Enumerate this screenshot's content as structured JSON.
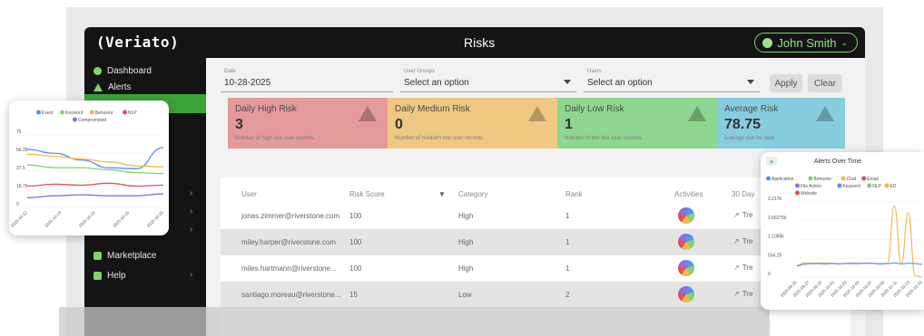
{
  "app": {
    "logo": "(Veriato)",
    "page_title": "Risks",
    "user": {
      "name": "John Smith"
    }
  },
  "sidebar": {
    "items": [
      {
        "label": "Dashboard",
        "icon": "dashboard-icon"
      },
      {
        "label": "Alerts",
        "icon": "alert-icon"
      },
      {
        "label": "Marketplace",
        "icon": "marketplace-icon"
      },
      {
        "label": "Help",
        "icon": "help-icon"
      }
    ]
  },
  "filters": {
    "date": {
      "label": "Date",
      "value": "10-28-2025"
    },
    "user_groups": {
      "label": "User Groups",
      "value": "Select an option"
    },
    "users": {
      "label": "Users",
      "value": "Select an option"
    },
    "apply_label": "Apply",
    "clear_label": "Clear"
  },
  "kpis": [
    {
      "title": "Daily High Risk",
      "value": "3",
      "sub": "Number of high risk user records",
      "color": "#e59a9a"
    },
    {
      "title": "Daily Medium Risk",
      "value": "0",
      "sub": "Number of medium risk user records",
      "color": "#efc882"
    },
    {
      "title": "Daily Low Risk",
      "value": "1",
      "sub": "Number of low risk user records",
      "color": "#8fd690"
    },
    {
      "title": "Average Risk",
      "value": "78.75",
      "sub": "Average risk for date",
      "color": "#86cde0"
    }
  ],
  "table": {
    "columns": [
      "User",
      "Risk Score",
      "Category",
      "Rank",
      "Activities",
      "30 Day"
    ],
    "rows": [
      {
        "user": "jonas.zimmer@riverstone.com",
        "score": "100",
        "category": "High",
        "rank": "1",
        "trend": "Tre"
      },
      {
        "user": "miley.harper@riverstone.com",
        "score": "100",
        "category": "High",
        "rank": "1",
        "trend": "Tre"
      },
      {
        "user": "miles.hartmann@riverstone...",
        "score": "100",
        "category": "High",
        "rank": "1",
        "trend": "Tre"
      },
      {
        "user": "santiago.moreau@riverstone...",
        "score": "15",
        "category": "Low",
        "rank": "2",
        "trend": "Tre"
      }
    ]
  },
  "chart_data": [
    {
      "type": "line",
      "title": "",
      "legend": [
        "Event",
        "Keyword",
        "Behavior",
        "NLP",
        "Compromised"
      ],
      "colors": [
        "#5b8def",
        "#7fd36d",
        "#f2b84b",
        "#e74c5c",
        "#8e6be0"
      ],
      "x": [
        "2025-10-12",
        "2025-10-13",
        "2025-10-14",
        "2025-10-15",
        "2025-10-16"
      ],
      "y_ticks": [
        "75",
        "56.25",
        "37.5",
        "18.75",
        "0"
      ],
      "ylim": [
        0,
        75
      ],
      "series": [
        {
          "name": "Event",
          "values": [
            60,
            56,
            49,
            41,
            40,
            62
          ]
        },
        {
          "name": "Keyword",
          "values": [
            44,
            41,
            41,
            39,
            36,
            35
          ]
        },
        {
          "name": "Behavior",
          "values": [
            55,
            53,
            50,
            47,
            43,
            42
          ]
        },
        {
          "name": "NLP",
          "values": [
            22,
            24,
            23,
            25,
            22,
            23
          ]
        },
        {
          "name": "Compromised",
          "values": [
            10,
            12,
            13,
            12,
            12,
            14
          ]
        }
      ]
    },
    {
      "type": "line",
      "title": "Alerts Over Time",
      "legend": [
        "Application",
        "Behavior",
        "Chat",
        "Email",
        "File Action",
        "Keyword",
        "NLP",
        "ED",
        "Website"
      ],
      "colors": [
        "#5b8def",
        "#7fd36d",
        "#f2b84b",
        "#e74c5c",
        "#8e6be0",
        "#5b8def",
        "#7fd36d",
        "#f2b84b",
        "#e74c5c"
      ],
      "x": [
        "2025-09-25",
        "2025-09-27",
        "2025-09-29",
        "2025-10-01",
        "2025-10-03",
        "2025-10-05",
        "2025-10-07",
        "2025-10-09",
        "2025-10-11",
        "2025-10-13",
        "2025-10-15"
      ],
      "y_ticks": [
        "2.217k",
        "1.66275k",
        "1.1085k",
        "554.25",
        "0"
      ],
      "ylim": [
        0,
        2217
      ],
      "series": [
        {
          "name": "Chat",
          "values": [
            350,
            420,
            410,
            420,
            410,
            420,
            400,
            410,
            420,
            410,
            420,
            410,
            400,
            410,
            2100,
            380,
            1900,
            40,
            0
          ]
        },
        {
          "name": "Application",
          "values": [
            330,
            380,
            400,
            400,
            390,
            400,
            390,
            400,
            400,
            400,
            410,
            400,
            390,
            400,
            420,
            390,
            410,
            400,
            380
          ]
        }
      ]
    }
  ]
}
